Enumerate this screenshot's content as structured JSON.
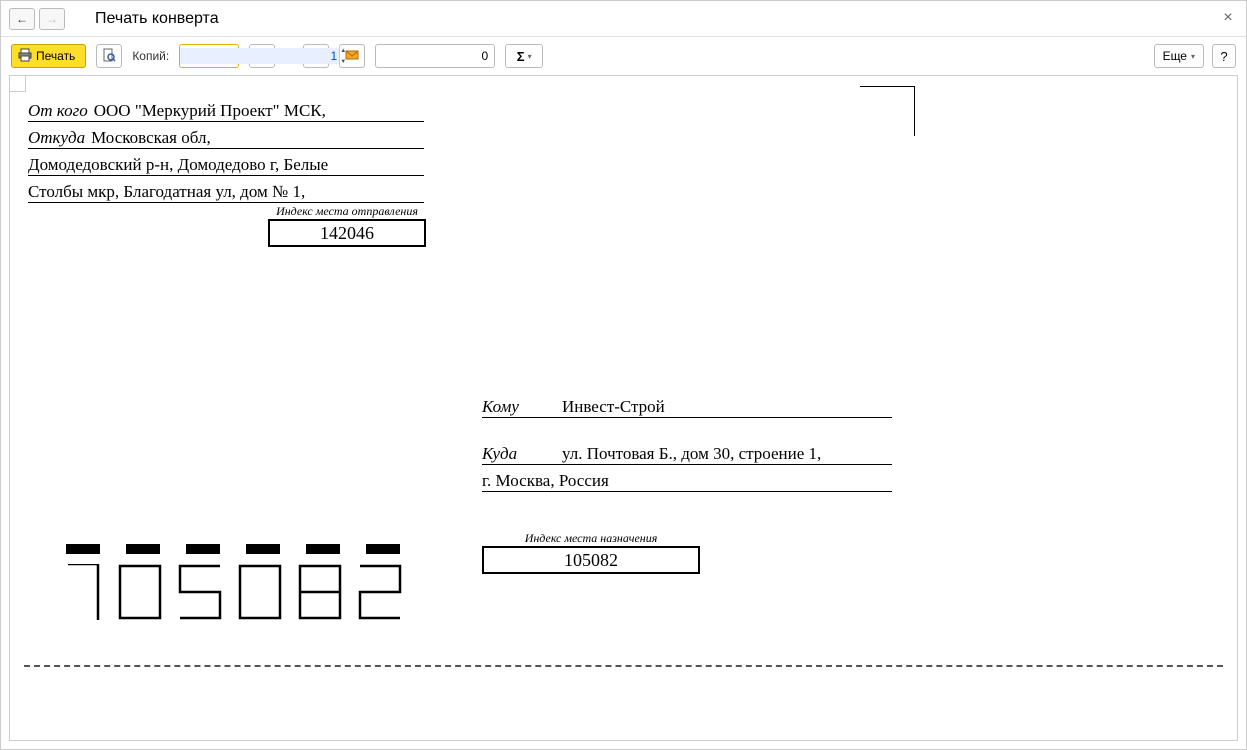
{
  "title": "Печать конверта",
  "toolbar": {
    "print_label": "Печать",
    "copies_label": "Копий:",
    "copies_value": "1",
    "number_value": "0",
    "more_label": "Еще",
    "help_label": "?"
  },
  "sender": {
    "from_label": "От кого",
    "from_value": "ООО \"Меркурий Проект\" МСК,",
    "where_label": "Откуда",
    "where_value": "Московская обл,",
    "addr_line2": "Домодедовский р-н, Домодедово г, Белые",
    "addr_line3": "Столбы мкр, Благодатная ул, дом № 1,",
    "index_caption": "Индекс места отправления",
    "index_value": "142046"
  },
  "recipient": {
    "to_label": "Кому",
    "to_value": "Инвест-Строй",
    "where_label": "Куда",
    "where_value": "ул. Почтовая Б., дом 30, строение 1,",
    "addr_line2": "г. Москва, Россия",
    "index_caption": "Индекс места назначения",
    "index_value": "105082"
  },
  "stencil_index": "105082"
}
